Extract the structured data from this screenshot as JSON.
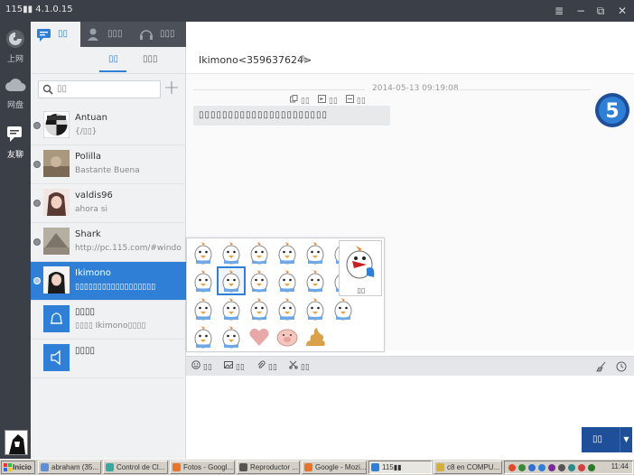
{
  "window": {
    "title": "115▮▮ 4.1.0.15",
    "controls": [
      "≣",
      "−",
      "⧉",
      "✕"
    ]
  },
  "rail": {
    "items": [
      {
        "label": "上网",
        "icon": "globe-icon"
      },
      {
        "label": "网盘",
        "icon": "cloud-icon"
      },
      {
        "label": "友聊",
        "icon": "chat-icon"
      }
    ]
  },
  "panel": {
    "tabs": [
      {
        "label": "▯▯",
        "icon": "chat-icon"
      },
      {
        "label": "▯▯▯",
        "icon": "contacts-icon"
      },
      {
        "label": "▯▯▯",
        "icon": "headset-icon"
      }
    ],
    "subtabs": [
      "▯▯",
      "▯▯▯"
    ],
    "search_placeholder": "▯▯",
    "add_label": "+",
    "contacts": [
      {
        "name": "Antuan",
        "message": "{/▯▯}"
      },
      {
        "name": "Polilla",
        "message": "Bastante Buena"
      },
      {
        "name": "valdis96",
        "message": "ahora si"
      },
      {
        "name": "Shark",
        "message": "http://pc.115.com/#windows"
      },
      {
        "name": "Ikimono",
        "message": "▯▯▯▯▯▯▯▯▯▯▯▯▯▯▯▯▯▯"
      },
      {
        "name": "▯▯▯▯",
        "message": "▯▯▯▯ Ikimono▯▯▯▯"
      },
      {
        "name": "▯▯▯▯",
        "message": ""
      }
    ]
  },
  "chat": {
    "peer": "Ikimono<359637624>",
    "edit_icon": "✎",
    "timestamp": "2014-05-13 09:19:08",
    "msg_tools": [
      "▯▯",
      "▯▯",
      "▯▯"
    ],
    "bubble": "▯▯▯▯▯▯▯▯▯▯▯▯▯▯▯▯▯▯▯▯▯▯",
    "badge": "5",
    "preview_label": "▯▯",
    "toolbar": [
      "▯▯",
      "▯▯",
      "▯▯",
      "▯▯"
    ],
    "send_label": "▯▯"
  },
  "taskbar": {
    "start": "Inicio",
    "tasks": [
      "abraham (35...",
      "Control de Cl...",
      "Fotos - Googl...",
      "Reproductor ...",
      "Google - Mozi...",
      "115▮▮",
      "c8 en COMPU..."
    ],
    "clock": "11:44"
  },
  "colors": {
    "accent": "#2f7fd6",
    "rail": "#3b4048",
    "send": "#1f4f98"
  }
}
